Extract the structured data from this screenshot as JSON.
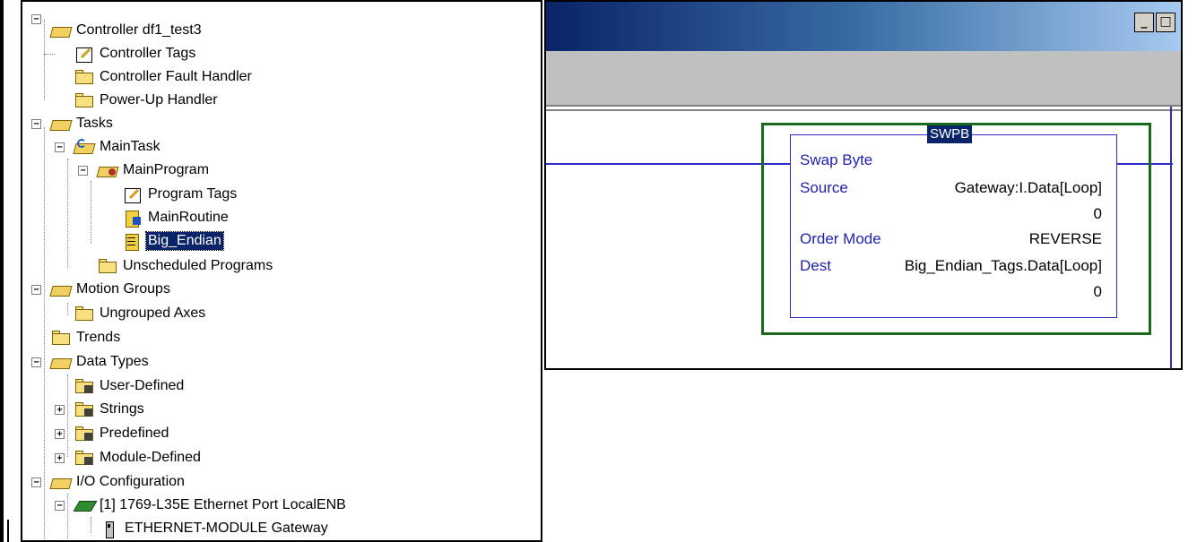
{
  "tree": {
    "controller": "Controller df1_test3",
    "controller_tags": "Controller Tags",
    "fault_handler": "Controller Fault Handler",
    "powerup_handler": "Power-Up Handler",
    "tasks": "Tasks",
    "main_task": "MainTask",
    "main_program": "MainProgram",
    "program_tags": "Program Tags",
    "main_routine": "MainRoutine",
    "big_endian": "Big_Endian",
    "unscheduled": "Unscheduled Programs",
    "motion_groups": "Motion Groups",
    "ungrouped_axes": "Ungrouped Axes",
    "trends": "Trends",
    "data_types": "Data Types",
    "user_defined": "User-Defined",
    "strings": "Strings",
    "predefined": "Predefined",
    "module_defined": "Module-Defined",
    "io_config": "I/O Configuration",
    "port": "[1] 1769-L35E Ethernet Port LocalENB",
    "ethernet_module": "ETHERNET-MODULE Gateway"
  },
  "window": {
    "minimize": "_",
    "restore": "□"
  },
  "instruction": {
    "name": "SWPB",
    "description": "Swap Byte",
    "source_label": "Source",
    "source_value": "Gateway:I.Data[Loop]",
    "source_current": "0",
    "order_label": "Order Mode",
    "order_value": "REVERSE",
    "dest_label": "Dest",
    "dest_value": "Big_Endian_Tags.Data[Loop]",
    "dest_current": "0"
  }
}
